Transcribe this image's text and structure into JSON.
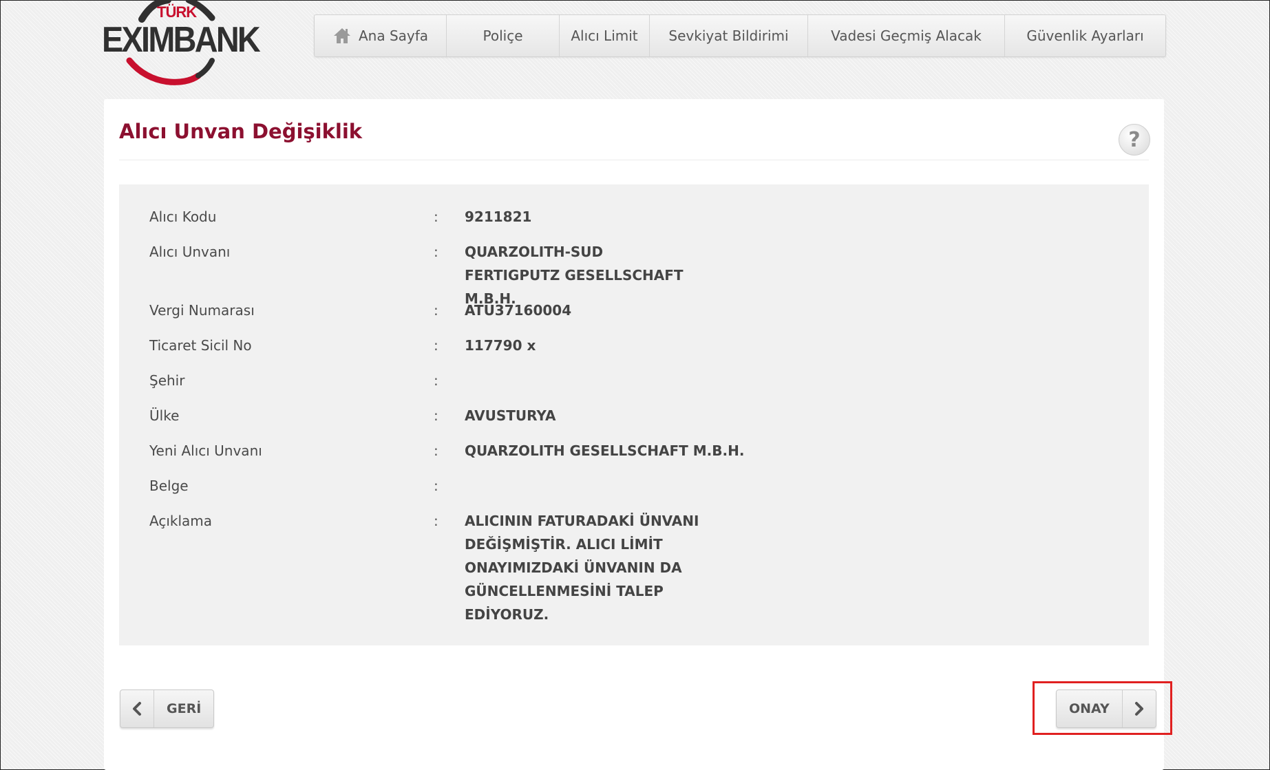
{
  "brand": {
    "turk": "TÜRK",
    "name": "EXIMBANK"
  },
  "nav": [
    {
      "label": "Ana Sayfa",
      "icon": "home-icon"
    },
    {
      "label": "Poliçe"
    },
    {
      "label": "Alıcı Limit"
    },
    {
      "label": "Sevkiyat Bildirimi"
    },
    {
      "label": "Vadesi Geçmiş Alacak"
    },
    {
      "label": "Güvenlik Ayarları"
    }
  ],
  "page": {
    "title": "Alıcı Unvan Değişiklik",
    "help_glyph": "?"
  },
  "fields": [
    {
      "label": "Alıcı Kodu",
      "colon": ":",
      "value": "9211821"
    },
    {
      "label": "Alıcı Unvanı",
      "colon": ":",
      "value": "QUARZOLITH-SUD FERTIGPUTZ GESELLSCHAFT M.B.H."
    },
    {
      "label": "Vergi Numarası",
      "colon": ":",
      "value": "ATU37160004"
    },
    {
      "label": "Ticaret Sicil No",
      "colon": ":",
      "value": "117790 x"
    },
    {
      "label": "Şehir",
      "colon": ":",
      "value": ""
    },
    {
      "label": "Ülke",
      "colon": ":",
      "value": "AVUSTURYA"
    },
    {
      "label": "Yeni Alıcı Unvanı",
      "colon": ":",
      "value": "QUARZOLITH GESELLSCHAFT M.B.H."
    },
    {
      "label": "Belge",
      "colon": ":",
      "value": ""
    },
    {
      "label": "Açıklama",
      "colon": ":",
      "value": "ALICININ FATURADAKİ ÜNVANI DEĞİŞMİŞTİR. ALICI LİMİT ONAYIMIZDAKİ ÜNVANIN DA GÜNCELLENMESİNİ TALEP EDİYORUZ."
    }
  ],
  "buttons": {
    "back_label": "GERİ",
    "confirm_label": "ONAY"
  },
  "colors": {
    "title": "#8c1030",
    "brand_red": "#c8102e",
    "highlight": "#e02020"
  }
}
